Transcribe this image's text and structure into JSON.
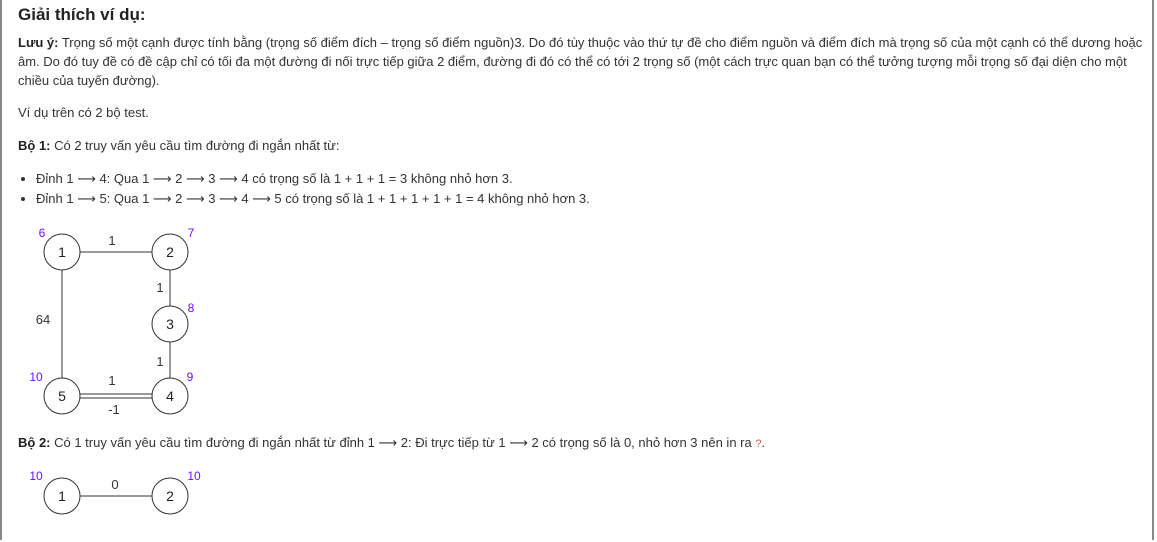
{
  "title": "Giải thích ví dụ:",
  "note": {
    "label": "Lưu ý:",
    "text": " Trọng số một cạnh được tính bằng (trọng số điểm đích – trọng số điểm nguồn)3. Do đó tùy thuộc vào thứ tự đề cho điểm nguồn và điểm đích mà trọng số của một cạnh có thể dương hoặc âm. Do đó tuy đề có đề cập chỉ có tối đa một đường đi nối trực tiếp giữa 2 điểm, đường đi đó có thể có tới 2 trọng số (một cách trực quan bạn có thể tưởng tượng mỗi trọng số đại diện cho một chiều của tuyến đường)."
  },
  "intro": "Ví dụ trên có 2 bộ test.",
  "test1": {
    "label": "Bộ 1:",
    "text": " Có 2 truy vấn yêu cầu tìm đường đi ngắn nhất từ:",
    "items": [
      "Đỉnh 1 ⟶ 4: Qua 1 ⟶ 2 ⟶ 3 ⟶ 4 có trọng số là 1 + 1 + 1 = 3 không nhỏ hơn 3.",
      "Đỉnh 1 ⟶ 5: Qua 1 ⟶ 2 ⟶ 3 ⟶ 4 ⟶ 5 có trọng số là 1 + 1 + 1 + 1 + 1 = 4 không nhỏ hơn 3."
    ]
  },
  "test2": {
    "label": "Bộ 2:",
    "text": " Có 1 truy vấn yêu cầu tìm đường đi ngắn nhất từ đỉnh 1 ⟶ 2: Đi trực tiếp từ 1 ⟶ 2 có trọng số là 0, nhỏ hơn 3 nên in ra ",
    "answer": "?",
    "end": "."
  },
  "graph1": {
    "nodes": [
      {
        "id": "1",
        "weight": "6"
      },
      {
        "id": "2",
        "weight": "7"
      },
      {
        "id": "3",
        "weight": "8"
      },
      {
        "id": "4",
        "weight": "9"
      },
      {
        "id": "5",
        "weight": "10"
      }
    ],
    "edges": [
      {
        "from": "1",
        "to": "2",
        "label": "1"
      },
      {
        "from": "2",
        "to": "3",
        "label": "1"
      },
      {
        "from": "3",
        "to": "4",
        "label": "1"
      },
      {
        "from": "4",
        "to": "5",
        "label": "1"
      },
      {
        "from": "5",
        "to": "4",
        "label": "-1"
      },
      {
        "from": "1",
        "to": "5",
        "label": "64"
      }
    ]
  },
  "graph2": {
    "nodes": [
      {
        "id": "1",
        "weight": "10"
      },
      {
        "id": "2",
        "weight": "10"
      }
    ],
    "edges": [
      {
        "from": "1",
        "to": "2",
        "label": "0"
      }
    ]
  },
  "colors": {
    "node_weight": "#6a11ff",
    "answer": "#d9534f"
  }
}
